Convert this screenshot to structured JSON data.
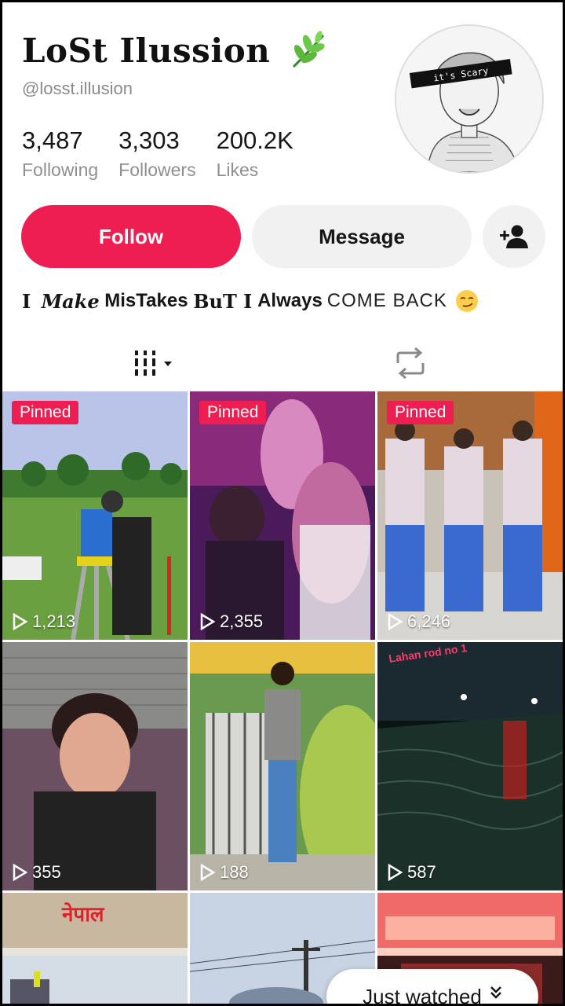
{
  "profile": {
    "display_name": "LoSt Ilussion",
    "username": "@losst.illusion",
    "avatar_caption": "it's Scary",
    "stats": [
      {
        "value": "3,487",
        "label": "Following"
      },
      {
        "value": "3,303",
        "label": "Followers"
      },
      {
        "value": "200.2K",
        "label": "Likes"
      }
    ]
  },
  "actions": {
    "follow_label": "Follow",
    "message_label": "Message"
  },
  "bio": {
    "part1": "I",
    "part2": "Make",
    "part3": "MisTakes",
    "part4": "BuT I",
    "part5": "Always",
    "part6": "COME BACK"
  },
  "tabs": {
    "videos_icon": "grid-icon",
    "repost_icon": "repost-icon"
  },
  "videos": [
    {
      "views": "1,213",
      "pinned": "Pinned"
    },
    {
      "views": "2,355",
      "pinned": "Pinned"
    },
    {
      "views": "6,246",
      "pinned": "Pinned"
    },
    {
      "views": "355"
    },
    {
      "views": "188"
    },
    {
      "views": "587",
      "overlay_text": "Lahan rod no 1"
    },
    {
      "overlay_text": "नेपाल"
    },
    {},
    {}
  ],
  "just_watched": "Just watched",
  "colors": {
    "accent": "#ee1d52",
    "secondary_button": "#f1f1f2",
    "muted_text": "#8a8a8a"
  }
}
